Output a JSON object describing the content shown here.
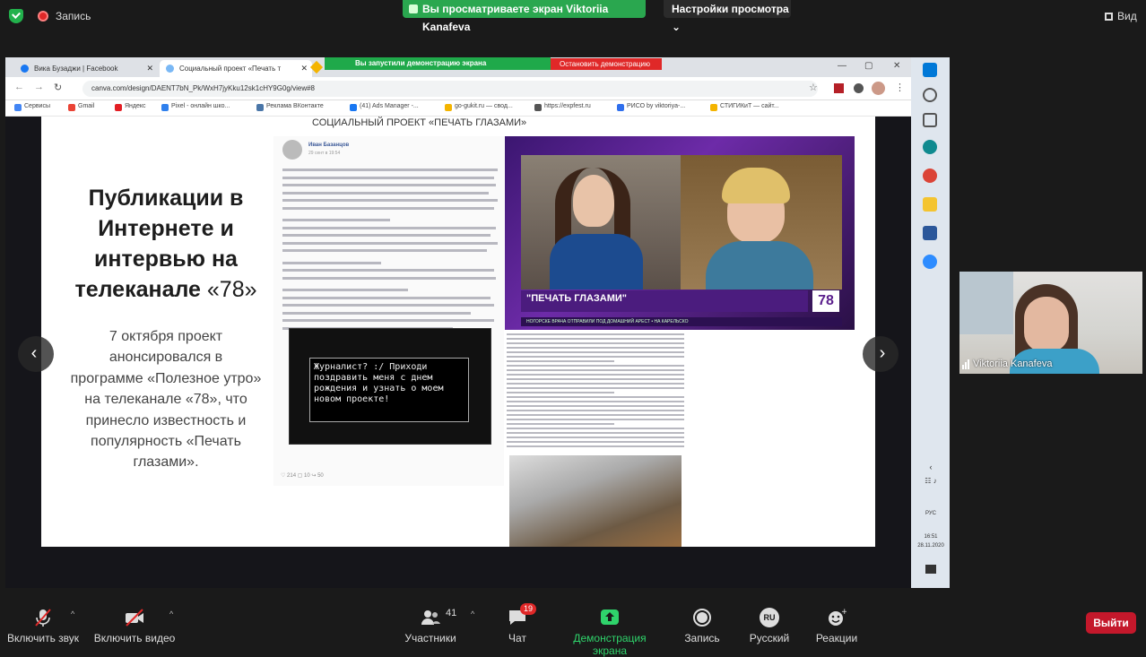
{
  "top": {
    "recording_label": "Запись",
    "share_banner": "Вы просматриваете экран Viktoriia Kanafeva",
    "view_options": "Настройки просмотра",
    "view_button": "Вид"
  },
  "browser": {
    "tabs": [
      "Вика Бузаджи | Facebook",
      "Социальный проект «Печать т"
    ],
    "share_notice": "Вы запустили демонстрацию экрана",
    "stop_share": "Остановить демонстрацию",
    "url": "canva.com/design/DAENT7bN_Pk/WxH7jyKku12sk1cHY9G0g/view#8",
    "bookmarks": [
      "Сервисы",
      "Gmail",
      "Яндекс",
      "Pixel - онлайн шко...",
      "Реклама ВКонтакте",
      "(41) Ads Manager -...",
      "go-gukit.ru — свод...",
      "https://expfest.ru",
      "PИСО by viktoriya-...",
      "СТИГИКиТ — сайт..."
    ]
  },
  "slide": {
    "header": "СОЦИАЛЬНЫЙ ПРОЕКТ «ПЕЧАТЬ ГЛАЗАМИ»",
    "title_lines": [
      "Публикации в",
      "Интернете и",
      "интервью на",
      "телеканале"
    ],
    "title_quote": "«78»",
    "body_lines": [
      "7 октября проект",
      "анонсировался в",
      "программе «Полезное утро»",
      "на телеканале «78», что",
      "принесло известность и",
      "популярность «Печать",
      "глазами»."
    ],
    "post_author": "Иван Базанцов",
    "post_date": "29 сент в 19:54",
    "terminal_text": "Журналист? :/ Приходи поздравить меня с днем рождения и узнать о моем новом проекте!",
    "post_stats": "♡ 214   ▢ 10   ↪ 50",
    "tv_caption": "\"ПЕЧАТЬ ГЛАЗАМИ\"",
    "tv_channel": "78",
    "tv_ticker": "НОГОРСКЕ ВРАЧА ОТПРАВИЛИ ПОД ДОМАШНИЙ АРЕСТ  •  НА КАРЕЛЬСКО"
  },
  "taskbar": {
    "lang": "РУС",
    "time": "16:51",
    "date": "28.11.2020"
  },
  "participant": {
    "name": "Viktoriia Kanafeva"
  },
  "toolbar": {
    "mute": "Включить звук",
    "video": "Включить видео",
    "participants": "Участники",
    "participants_count": "41",
    "chat": "Чат",
    "chat_badge": "19",
    "share": "Демонстрация экрана",
    "record": "Запись",
    "language": "Русский",
    "language_code": "RU",
    "reactions": "Реакции",
    "leave": "Выйти"
  },
  "colors": {
    "accent_green": "#2aa74f",
    "leave_red": "#c4182b",
    "tv_purple": "#5a1e8c"
  }
}
